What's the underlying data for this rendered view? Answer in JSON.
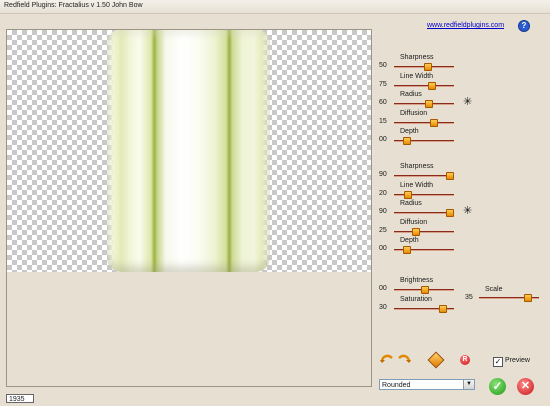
{
  "window": {
    "title": "Redfield Plugins: Fractalius v 1.50   John Bow"
  },
  "header": {
    "link_text": "www.redfieldplugins.com",
    "help_icon": "?"
  },
  "controls": {
    "group1": [
      {
        "label": "Sharpness",
        "value": "50",
        "level": 0.55
      },
      {
        "label": "Line Width",
        "value": "75",
        "level": 0.62
      },
      {
        "label": "Radius",
        "value": "60",
        "level": 0.57
      },
      {
        "label": "Diffusion",
        "value": "15",
        "level": 0.65
      },
      {
        "label": "Depth",
        "value": "00",
        "level": 0.2
      }
    ],
    "group2": [
      {
        "label": "Sharpness",
        "value": "90",
        "level": 0.92
      },
      {
        "label": "Line Width",
        "value": "20",
        "level": 0.22
      },
      {
        "label": "Radius",
        "value": "90",
        "level": 0.92
      },
      {
        "label": "Diffusion",
        "value": "25",
        "level": 0.35
      },
      {
        "label": "Depth",
        "value": "00",
        "level": 0.2
      }
    ],
    "group3": [
      {
        "label": "Brightness",
        "value": "00",
        "level": 0.5
      },
      {
        "label": "Saturation",
        "value": "30",
        "level": 0.8
      }
    ],
    "scale": {
      "label": "Scale",
      "value": "35",
      "level": 0.8
    },
    "random_icon": "asterisk-icon"
  },
  "bottom": {
    "preview_label": "Preview",
    "preview_checked": true,
    "checkmark": "✓",
    "shape_value": "Rounded",
    "dropdown_arrow": "▼",
    "reset_label": "R",
    "ok_symbol": "✓",
    "cancel_symbol": "✕",
    "status_value": "1935"
  },
  "colors": {
    "accent_thumb": "#f0a020",
    "track": "#8a2a1a"
  }
}
